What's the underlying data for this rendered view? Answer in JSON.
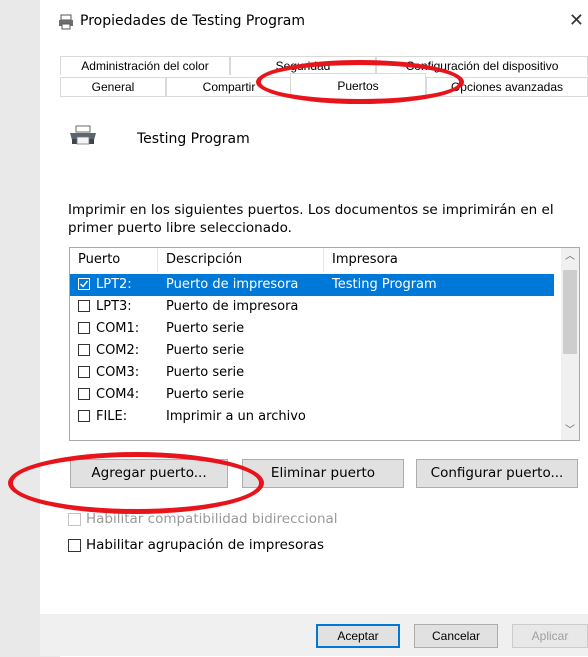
{
  "window": {
    "title": "Propiedades de Testing Program",
    "close_glyph": "✕"
  },
  "tabs": {
    "row1": [
      {
        "label": "Administración del color"
      },
      {
        "label": "Seguridad"
      },
      {
        "label": "Configuración del dispositivo"
      }
    ],
    "row2": [
      {
        "label": "General"
      },
      {
        "label": "Compartir"
      },
      {
        "label": "Puertos"
      },
      {
        "label": "Opciones avanzadas"
      }
    ],
    "active": "Puertos"
  },
  "printer": {
    "name": "Testing Program",
    "icon": "printer-icon"
  },
  "ports": {
    "description": "Imprimir en los siguientes puertos. Los documentos se imprimirán en el primer puerto libre seleccionado.",
    "columns": [
      "Puerto",
      "Descripción",
      "Impresora"
    ],
    "rows": [
      {
        "port": "LPT2:",
        "desc": "Puerto de impresora",
        "printer": "Testing Program",
        "checked": true,
        "selected": true
      },
      {
        "port": "LPT3:",
        "desc": "Puerto de impresora",
        "printer": "",
        "checked": false,
        "selected": false
      },
      {
        "port": "COM1:",
        "desc": "Puerto serie",
        "printer": "",
        "checked": false,
        "selected": false
      },
      {
        "port": "COM2:",
        "desc": "Puerto serie",
        "printer": "",
        "checked": false,
        "selected": false
      },
      {
        "port": "COM3:",
        "desc": "Puerto serie",
        "printer": "",
        "checked": false,
        "selected": false
      },
      {
        "port": "COM4:",
        "desc": "Puerto serie",
        "printer": "",
        "checked": false,
        "selected": false
      },
      {
        "port": "FILE:",
        "desc": "Imprimir a un archivo",
        "printer": "",
        "checked": false,
        "selected": false
      }
    ]
  },
  "buttons": {
    "add": "Agregar puerto...",
    "remove": "Eliminar puerto",
    "configure": "Configurar puerto..."
  },
  "options": {
    "bidirectional": {
      "label": "Habilitar compatibilidad bidireccional",
      "checked": false,
      "enabled": false
    },
    "pooling": {
      "label": "Habilitar agrupación de impresoras",
      "checked": false,
      "enabled": true
    }
  },
  "footer": {
    "ok": "Aceptar",
    "cancel": "Cancelar",
    "apply": "Aplicar"
  },
  "colors": {
    "selection": "#0078d7",
    "annotation": "#e8141c"
  }
}
